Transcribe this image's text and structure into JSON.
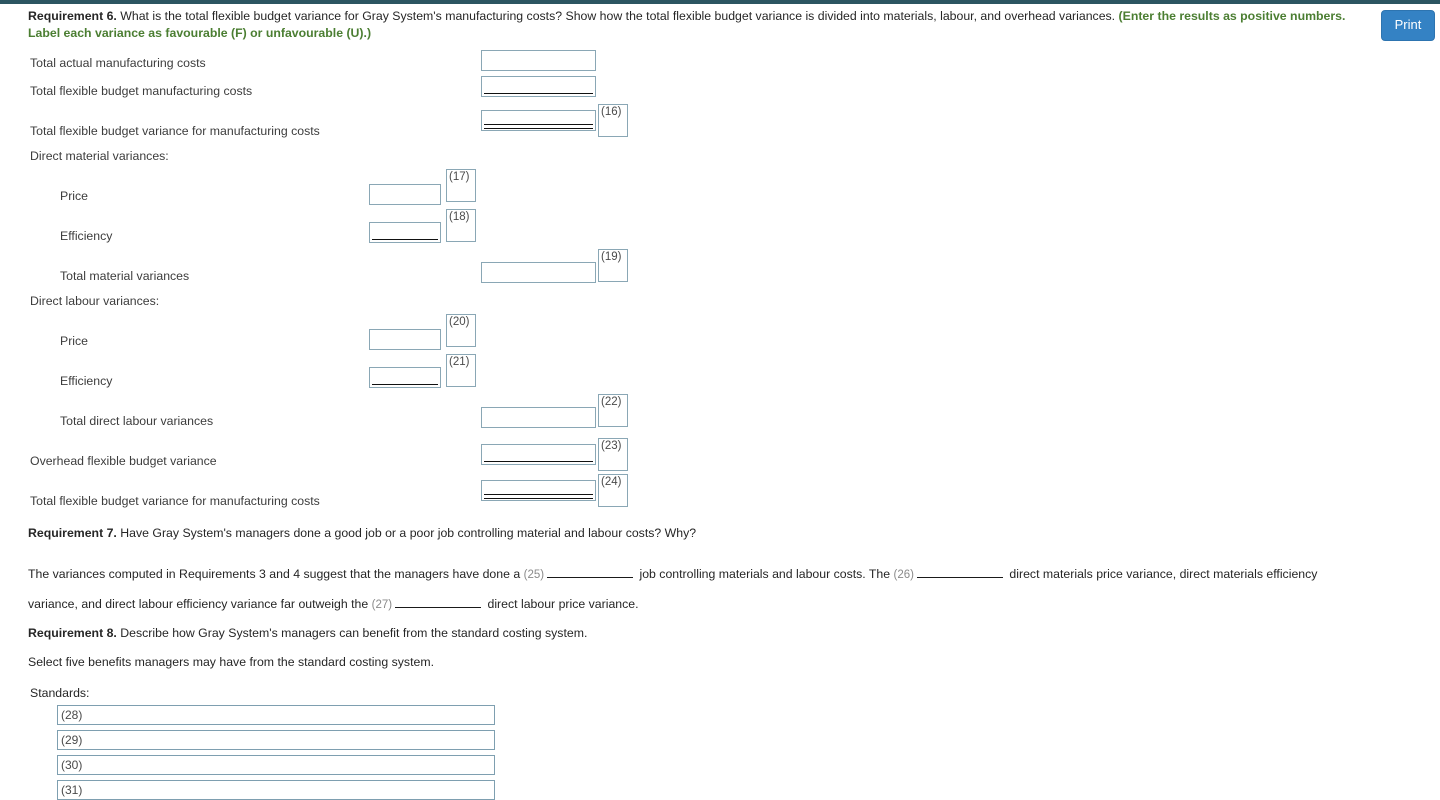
{
  "topbar": {
    "color": "#2c5561"
  },
  "toolbar": {
    "print_label": "Print"
  },
  "requirement6": {
    "title": "Requirement 6.",
    "prompt": "What is the total flexible budget variance for Gray System's manufacturing costs? Show how the total flexible budget variance is divided into materials, labour, and overhead variances.",
    "green_line1": "(Enter the results as positive numbers.",
    "green_line2": "Label each variance as favourable (F) or unfavourable (U).)",
    "rows": [
      {
        "label": "Total actual manufacturing costs",
        "tag": ""
      },
      {
        "label": "Total flexible budget manufacturing costs",
        "tag": ""
      },
      {
        "label": "Total flexible budget variance for manufacturing costs",
        "tag": "(16)"
      },
      {
        "label": "Direct material variances:",
        "tag": ""
      },
      {
        "label": "Price",
        "tag": "(17)"
      },
      {
        "label": "Efficiency",
        "tag": "(18)"
      },
      {
        "label": "Total material variances",
        "tag": "(19)"
      },
      {
        "label": "Direct labour variances:",
        "tag": ""
      },
      {
        "label": "Price",
        "tag": "(20)"
      },
      {
        "label": "Efficiency",
        "tag": "(21)"
      },
      {
        "label": "Total direct labour variances",
        "tag": "(22)"
      },
      {
        "label": "Overhead flexible budget variance",
        "tag": "(23)"
      },
      {
        "label": "Total flexible budget variance for manufacturing costs",
        "tag": "(24)"
      }
    ]
  },
  "requirement7": {
    "title": "Requirement 7.",
    "prompt": "Have Gray System's managers done a good job or a poor job controlling material and labour costs? Why?",
    "line1_a": "The variances computed in Requirements 3 and 4 suggest that the managers have done a",
    "tag25": "(25)",
    "line1_b": "job controlling materials and labour costs. The",
    "tag26": "(26)",
    "line1_c": "direct materials price variance, direct materials efficiency",
    "line2_a": "variance, and direct labour efficiency variance far outweigh the",
    "tag27": "(27)",
    "line2_b": "direct labour price variance."
  },
  "requirement8": {
    "title": "Requirement 8.",
    "prompt": "Describe how Gray System's managers can benefit from the standard costing system.",
    "instruction": "Select five benefits managers may have from the standard costing system.",
    "list_label": "Standards:",
    "selects": [
      {
        "tag": "(28)"
      },
      {
        "tag": "(29)"
      },
      {
        "tag": "(30)"
      },
      {
        "tag": "(31)"
      }
    ]
  }
}
